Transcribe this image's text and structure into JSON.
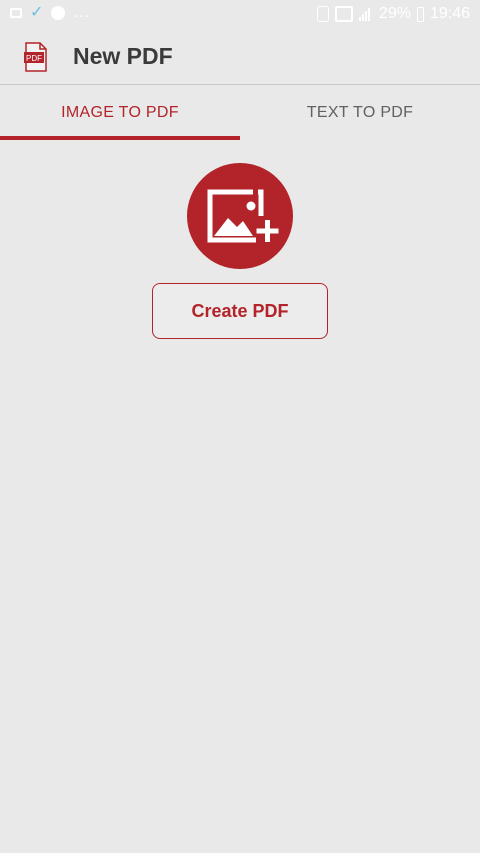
{
  "status_bar": {
    "dots": "...",
    "battery_percent": "29%",
    "time": "19:46"
  },
  "app_bar": {
    "title": "New PDF",
    "icon_label": "PDF"
  },
  "tabs": [
    {
      "label": "IMAGE TO PDF",
      "selected": true
    },
    {
      "label": "TEXT TO PDF",
      "selected": false
    }
  ],
  "main": {
    "create_button_label": "Create PDF"
  },
  "colors": {
    "accent": "#b3242a",
    "background": "#e9e9e9",
    "tab_inactive": "#616161",
    "title_text": "#3a3a3a"
  },
  "icons": {
    "add_image": "add-image-icon",
    "app": "pdf-file-icon"
  }
}
